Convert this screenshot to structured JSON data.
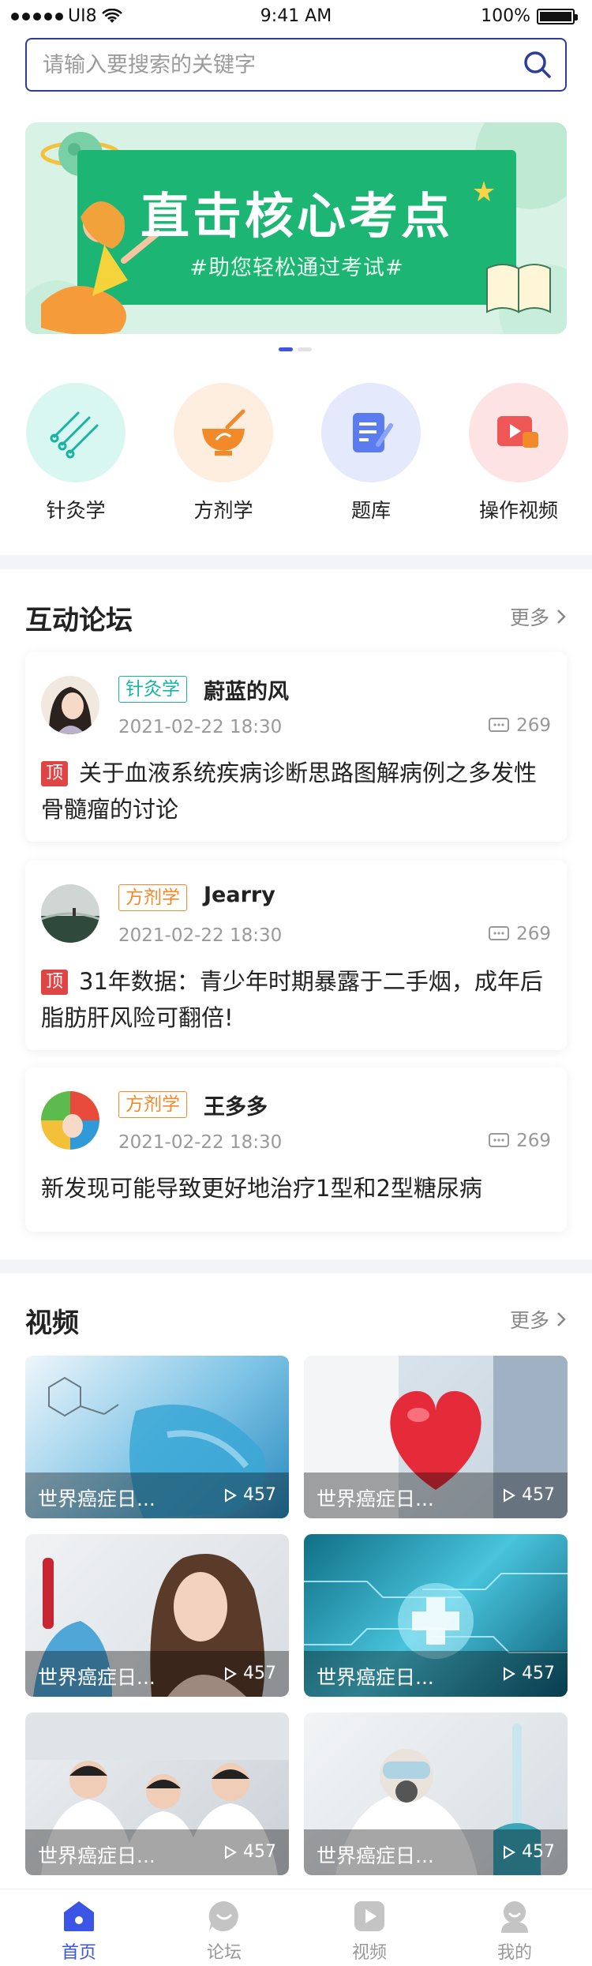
{
  "status_bar": {
    "carrier": "UI8",
    "time": "9:41 AM",
    "battery": "100%"
  },
  "search": {
    "placeholder": "请输入要搜索的关键字"
  },
  "banner": {
    "title": "直击核心考点",
    "subtitle": "#助您轻松通过考试#"
  },
  "quick_nav": [
    {
      "label": "针灸学",
      "icon": "needles-icon",
      "bg": "#d9f7f1",
      "color": "#19b3a3"
    },
    {
      "label": "方剂学",
      "icon": "mortar-icon",
      "bg": "#fdeee0",
      "color": "#f28a2a"
    },
    {
      "label": "题库",
      "icon": "quiz-icon",
      "bg": "#e4e9fc",
      "color": "#4a6de8"
    },
    {
      "label": "操作视频",
      "icon": "video-icon",
      "bg": "#fde3e3",
      "color": "#ef5656"
    }
  ],
  "forum": {
    "title": "互动论坛",
    "more": "更多",
    "posts": [
      {
        "tag": "针灸学",
        "tag_color": "#19b3a3",
        "user": "蔚蓝的风",
        "date": "2021-02-22 18:30",
        "comments": "269",
        "pinned": true,
        "pin_label": "顶",
        "text": "关于血液系统疾病诊断思路图解病例之多发性骨髓瘤的讨论"
      },
      {
        "tag": "方剂学",
        "tag_color": "#f28a2a",
        "user": "Jearry",
        "date": "2021-02-22 18:30",
        "comments": "269",
        "pinned": true,
        "pin_label": "顶",
        "text": "31年数据：青少年时期暴露于二手烟，成年后脂肪肝风险可翻倍!"
      },
      {
        "tag": "方剂学",
        "tag_color": "#f28a2a",
        "user": "王多多",
        "date": "2021-02-22 18:30",
        "comments": "269",
        "pinned": false,
        "pin_label": "",
        "text": "新发现可能导致更好地治疗1型和2型糖尿病"
      }
    ]
  },
  "videos": {
    "title": "视频",
    "more": "更多",
    "items": [
      {
        "title": "世界癌症日...",
        "views": "457"
      },
      {
        "title": "世界癌症日...",
        "views": "457"
      },
      {
        "title": "世界癌症日...",
        "views": "457"
      },
      {
        "title": "世界癌症日...",
        "views": "457"
      },
      {
        "title": "世界癌症日...",
        "views": "457"
      },
      {
        "title": "世界癌症日...",
        "views": "457"
      }
    ]
  },
  "tabbar": [
    {
      "label": "首页",
      "active": true
    },
    {
      "label": "论坛",
      "active": false
    },
    {
      "label": "视频",
      "active": false
    },
    {
      "label": "我的",
      "active": false
    }
  ],
  "colors": {
    "accent": "#2c3d9e",
    "tab_active": "#3b55e6",
    "tab_inactive": "#999999"
  }
}
